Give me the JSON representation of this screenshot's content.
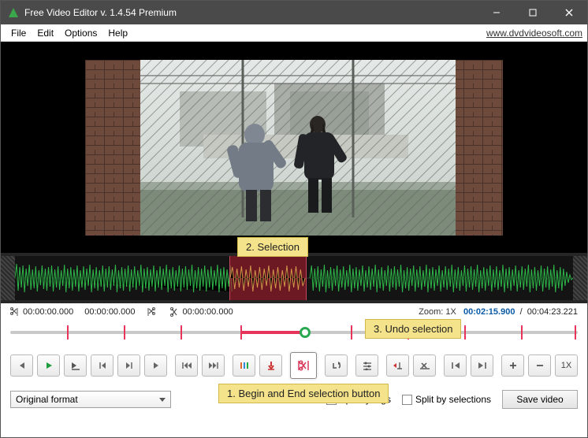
{
  "window": {
    "title": "Free Video Editor v. 1.4.54 Premium",
    "url": "www.dvdvideosoft.com"
  },
  "menu": [
    "File",
    "Edit",
    "Options",
    "Help"
  ],
  "annotations": {
    "selection": "2. Selection",
    "undo": "3. Undo selection",
    "begin_end": "1. Begin and End selection button"
  },
  "timecodes": {
    "trim_start": "00:00:00.000",
    "trim_end": "00:00:00.000",
    "cursor": "00:00:00.000",
    "zoom_label": "Zoom:",
    "zoom_value": "1X",
    "current": "00:02:15.900",
    "sep": "/",
    "total": "00:04:23.221"
  },
  "controls": {
    "zoom_btn": "1X"
  },
  "bottom": {
    "format": "Original format",
    "split_tags": "Split by tags",
    "split_selections": "Split by selections",
    "save": "Save video"
  }
}
